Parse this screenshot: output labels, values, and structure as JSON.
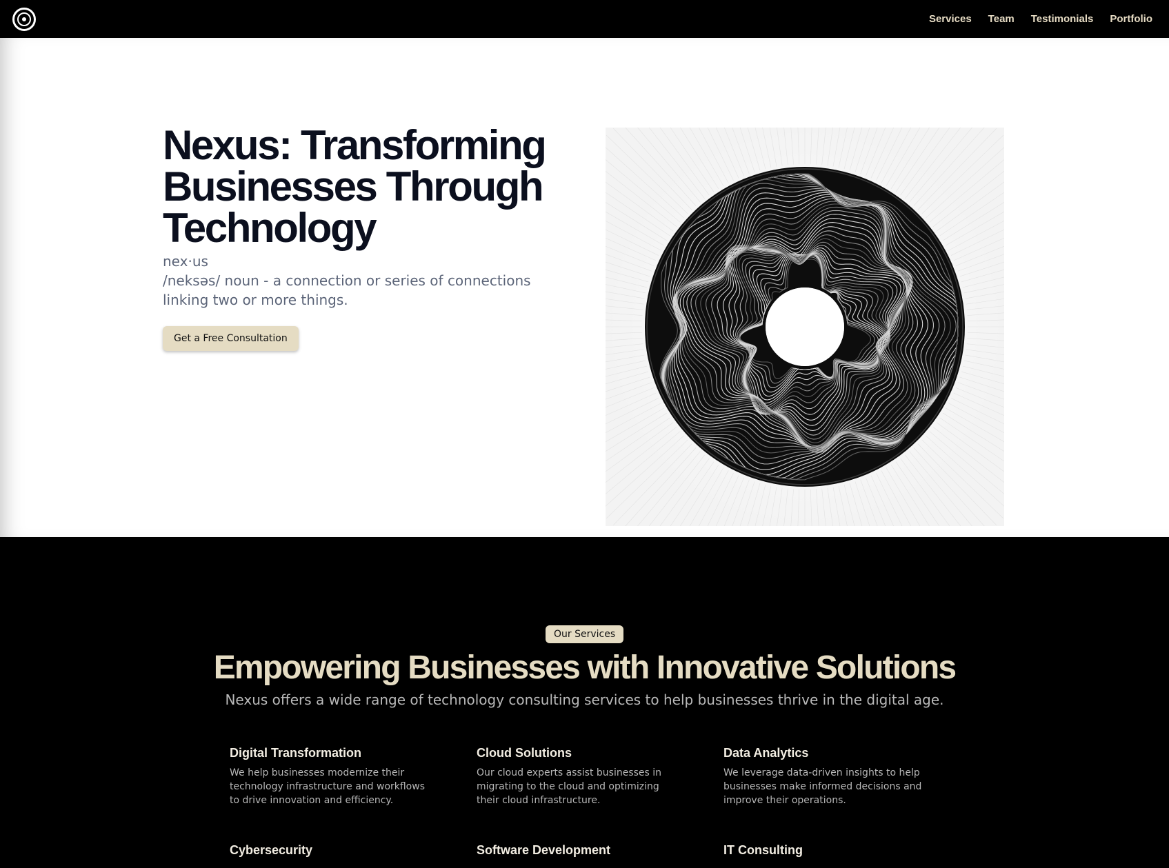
{
  "nav": {
    "links": [
      "Services",
      "Team",
      "Testimonials",
      "Portfolio"
    ]
  },
  "hero": {
    "title": "Nexus: Transforming Businesses Through Technology",
    "pronunciation": "nex·us\n/neksəs/ noun - a connection or series of connections linking two or more things.",
    "cta_label": "Get a Free Consultation"
  },
  "services": {
    "badge": "Our Services",
    "title": "Empowering Businesses with Innovative Solutions",
    "subtitle": "Nexus offers a wide range of technology consulting services to help businesses thrive in the digital age.",
    "items": [
      {
        "title": "Digital Transformation",
        "desc": "We help businesses modernize their technology infrastructure and workflows to drive innovation and efficiency."
      },
      {
        "title": "Cloud Solutions",
        "desc": "Our cloud experts assist businesses in migrating to the cloud and optimizing their cloud infrastructure."
      },
      {
        "title": "Data Analytics",
        "desc": "We leverage data-driven insights to help businesses make informed decisions and improve their operations."
      },
      {
        "title": "Cybersecurity",
        "desc": ""
      },
      {
        "title": "Software Development",
        "desc": ""
      },
      {
        "title": "IT Consulting",
        "desc": ""
      }
    ]
  }
}
